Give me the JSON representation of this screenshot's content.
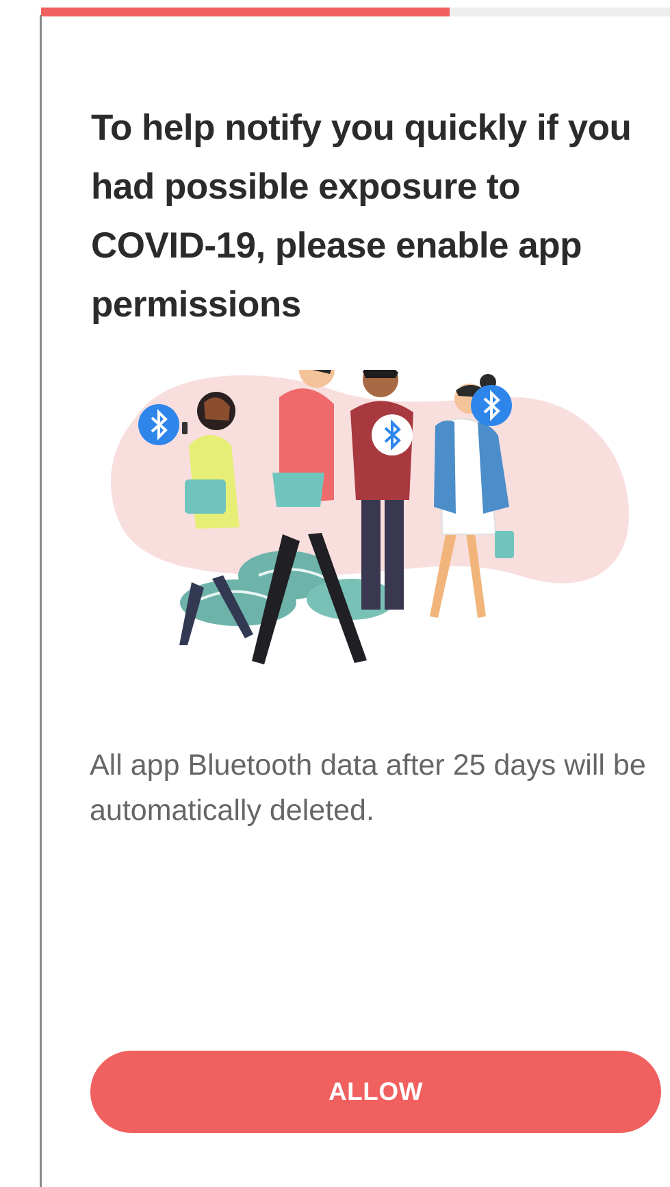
{
  "progress": {
    "fraction": 0.65,
    "fill_color": "#f0605f",
    "track_color": "#eeeeee"
  },
  "headline": "To help notify you quickly if you had possible exposure to COVID-19, please enable app permissions",
  "illustration": {
    "icon": "bluetooth-icon"
  },
  "note": "All app Bluetooth data after 25 days will be automatically deleted.",
  "allow_button": {
    "label": "ALLOW",
    "color": "#f0605f"
  }
}
